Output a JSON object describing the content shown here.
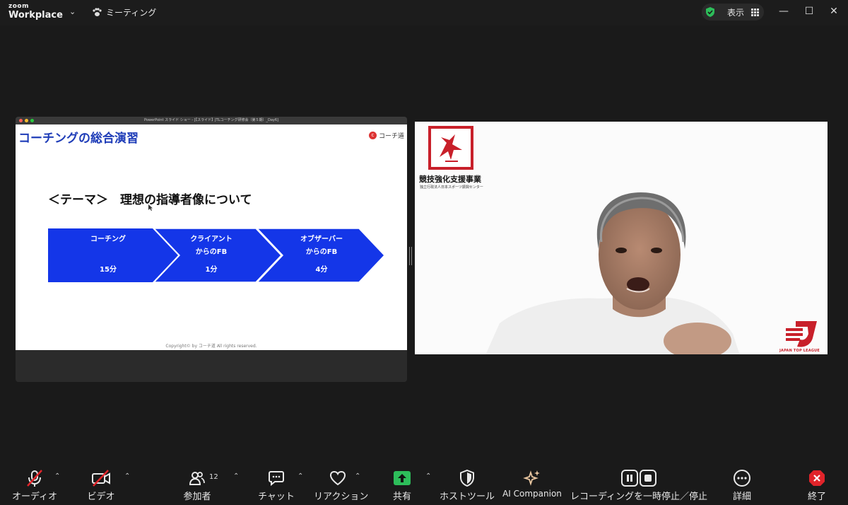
{
  "titlebar": {
    "brand_top": "zoom",
    "brand_bottom": "Workplace",
    "meeting_label": "ミーティング",
    "view_label": "表示"
  },
  "share": {
    "window_title": "PowerPoint スライド ショー - [【スライド】JTLコーチング研修会（第５期）_Day6]",
    "slide_title": "コーチングの総合演習",
    "logo_text": "コーチ道",
    "theme": "＜テーマ＞　理想の指導者像について",
    "steps": [
      {
        "line1": "コーチング",
        "line2": "",
        "time": "15分"
      },
      {
        "line1": "クライアント",
        "line2": "からのFB",
        "time": "1分"
      },
      {
        "line1": "オブザーバー",
        "line2": "からのFB",
        "time": "4分"
      }
    ],
    "copyright": "Copyright© by コーチ道 All rights reserved."
  },
  "video": {
    "org_title": "競技強化支援事業",
    "org_sub": "独立行政法人日本スポーツ振興センター",
    "league_label": "JAPAN TOP LEAGUE"
  },
  "toolbar": {
    "audio": "オーディオ",
    "video": "ビデオ",
    "participants": "参加者",
    "participants_count": "12",
    "chat": "チャット",
    "reactions": "リアクション",
    "share": "共有",
    "host_tools": "ホストツール",
    "ai": "AI Companion",
    "recording": "レコーディングを一時停止／停止",
    "more": "詳細",
    "end": "終了"
  },
  "colors": {
    "slide_blue": "#1f3db8",
    "chevron_blue": "#1436e8",
    "share_green": "#2dbd5a",
    "end_red": "#e0242a",
    "logo_red": "#c8202a"
  }
}
